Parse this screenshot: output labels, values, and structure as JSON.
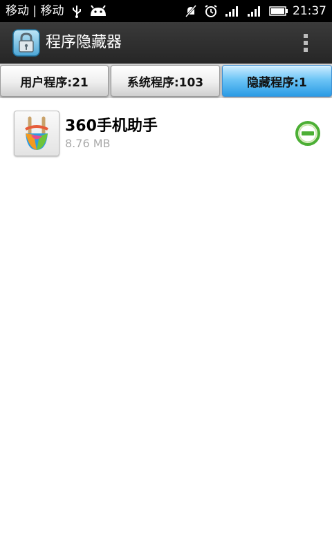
{
  "status_bar": {
    "carrier": "移动 | 移动",
    "time": "21:37"
  },
  "action_bar": {
    "title": "程序隐藏器",
    "icon": "padlock-icon",
    "menu_icon": "overflow-menu-icon"
  },
  "tabs": [
    {
      "label": "用户程序:21",
      "selected": false
    },
    {
      "label": "系统程序:103",
      "selected": false
    },
    {
      "label": "隐藏程序:1",
      "selected": true
    }
  ],
  "apps": [
    {
      "name": "360手机助手",
      "size": "8.76 MB",
      "icon": "360-assistant-icon",
      "action_icon": "remove-circle-icon"
    }
  ],
  "colors": {
    "status_bar": "#000000",
    "action_bar": "#2f2f2f",
    "selected_tab": "#2a9be4",
    "action_green": "#4caf35"
  }
}
